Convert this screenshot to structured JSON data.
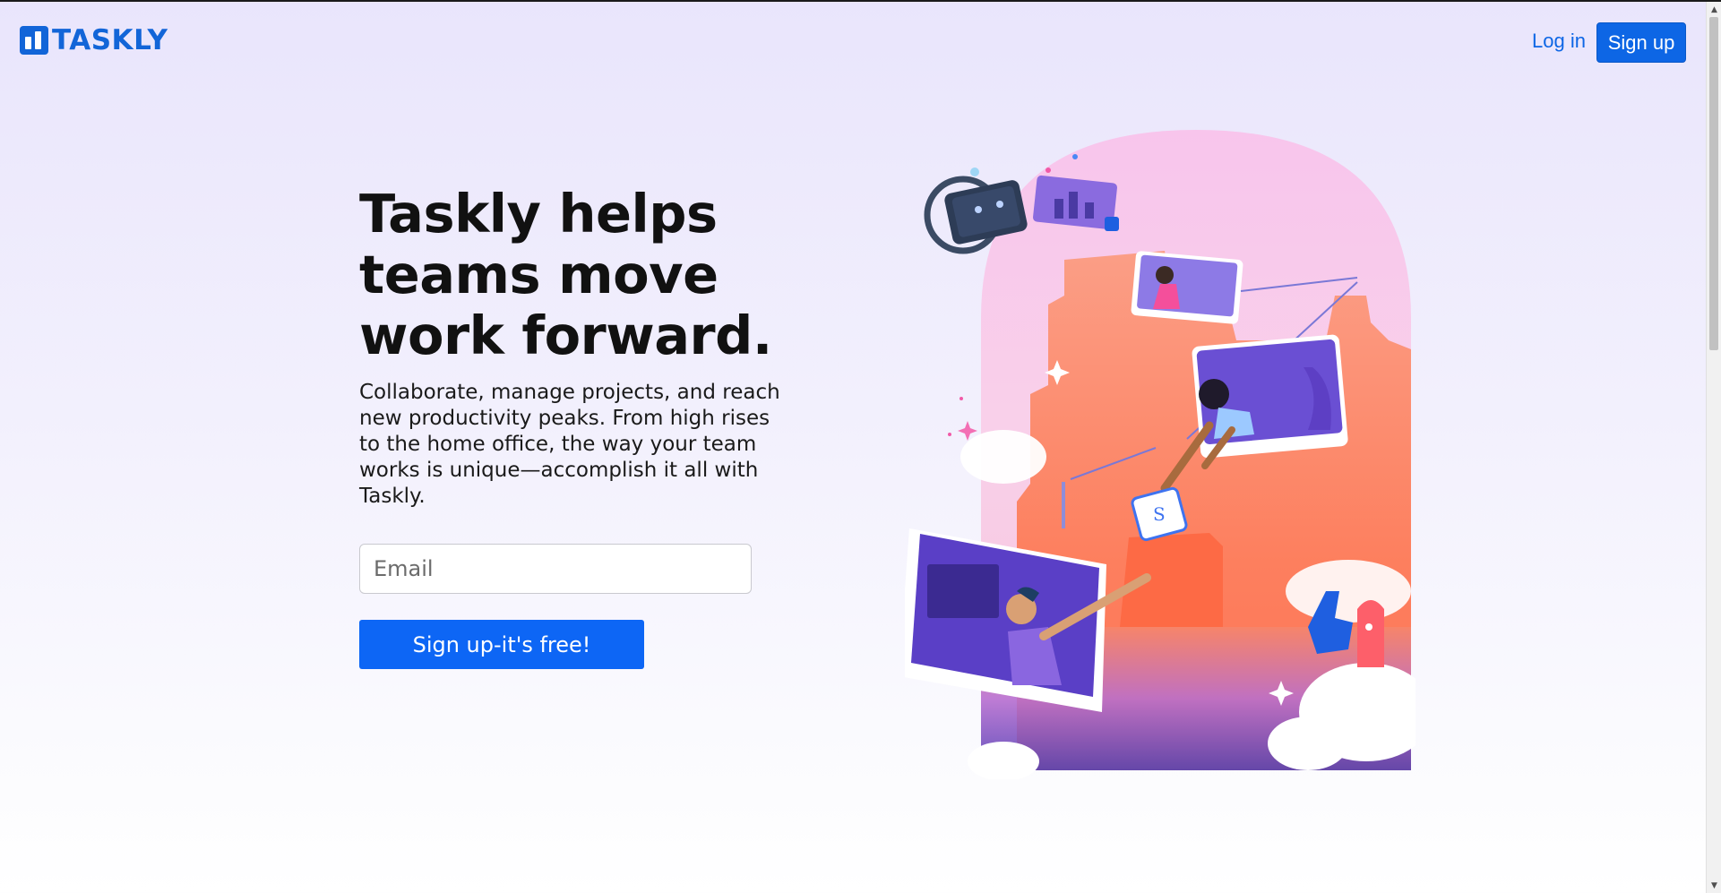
{
  "header": {
    "logo_text": "TASKLY",
    "login_label": "Log in",
    "signup_label": "Sign up"
  },
  "hero": {
    "title_line1": "Taskly helps",
    "title_line2": "teams move",
    "title_line3": "work forward.",
    "description": "Collaborate, manage projects, and reach new productivity peaks. From high rises to the home office, the way your team works is unique—accomplish it all with Taskly.",
    "email_placeholder": "Email",
    "cta_label": "Sign up-it's free!"
  },
  "illustration": {
    "paper_symbol": "S"
  },
  "colors": {
    "brand": "#1265d8",
    "primary_button": "#0d66f5",
    "background_top": "#e9e5fc"
  }
}
